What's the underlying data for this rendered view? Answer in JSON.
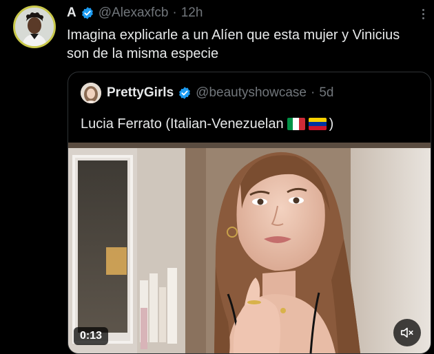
{
  "tweet": {
    "display_name": "A",
    "handle": "@Alexaxfcb",
    "separator": "·",
    "time": "12h",
    "text": "Imagina explicarle a un Alíen que esta mujer y Vinicius son de la misma especie"
  },
  "quote": {
    "display_name": "PrettyGirls",
    "handle": "@beautyshowcase",
    "separator": "·",
    "time": "5d",
    "text": "Lucia Ferrato (Italian-Venezuelan",
    "text_end": ")",
    "flags": [
      "italy-flag",
      "venezuela-flag"
    ],
    "video": {
      "duration": "0:13",
      "muted": true
    }
  },
  "colors": {
    "background": "#000000",
    "text_primary": "#e7e9ea",
    "text_secondary": "#71767b",
    "verified_blue": "#1d9bf0",
    "border": "#2f3336"
  },
  "icons": {
    "verified": "verified-badge-icon",
    "more": "more-options-icon",
    "mute": "volume-muted-icon"
  }
}
